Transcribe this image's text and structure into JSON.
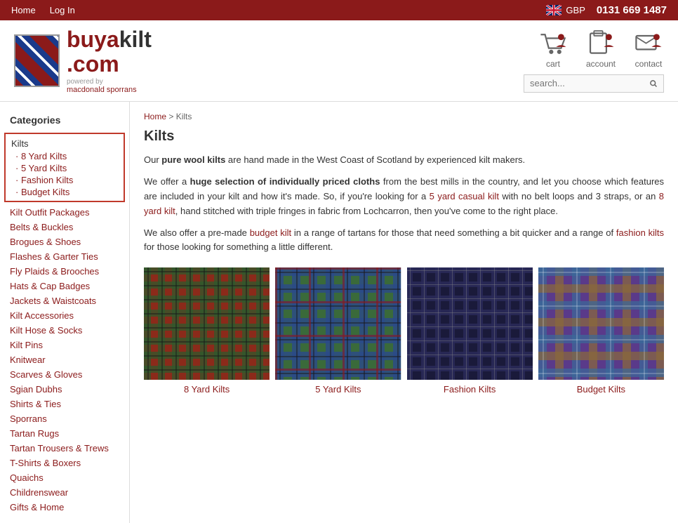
{
  "topnav": {
    "home": "Home",
    "login": "Log In",
    "currency": "GBP",
    "phone": "0131 669 1487"
  },
  "logo": {
    "brand_prefix": "buya",
    "brand_suffix": "kilt",
    "domain": ".com",
    "powered_by": "powered by",
    "powered_name": "macdonald sporrans"
  },
  "header_icons": {
    "cart_label": "cart",
    "account_label": "account",
    "contact_label": "contact"
  },
  "search": {
    "placeholder": "search..."
  },
  "breadcrumb": {
    "home": "Home",
    "separator": ">",
    "current": "Kilts"
  },
  "page_title": "Kilts",
  "content": {
    "para1_prefix": "Our ",
    "para1_bold": "pure wool kilts",
    "para1_suffix": " are hand made in the West Coast of Scotland by experienced kilt makers.",
    "para2_prefix": "We offer a ",
    "para2_bold": "huge selection of individually priced cloths",
    "para2_mid": " from the best mills in the country, and let you choose which features are included in your kilt and how it's made. So, if you're looking for a ",
    "para2_link1": "5 yard casual kilt",
    "para2_mid2": " with no belt loops and 3 straps, or an ",
    "para2_link2": "8 yard kilt",
    "para2_end": ", hand stitched with triple fringes in fabric from Lochcarron, then you've come to the right place.",
    "para3_prefix": "We also offer a pre-made ",
    "para3_link1": "budget kilt",
    "para3_mid": " in a range of tartans for those that need something a bit quicker and a range of ",
    "para3_link2": "fashion kilts",
    "para3_end": " for those looking for something a little different."
  },
  "sidebar": {
    "title": "Categories",
    "items": [
      {
        "label": "Kilts",
        "active": true,
        "subitems": [
          {
            "label": "· 8 Yard Kilts"
          },
          {
            "label": "· 5 Yard Kilts"
          },
          {
            "label": "· Fashion Kilts"
          },
          {
            "label": "· Budget Kilts"
          }
        ]
      },
      {
        "label": "Kilt Outfit Packages"
      },
      {
        "label": "Belts & Buckles"
      },
      {
        "label": "Brogues & Shoes"
      },
      {
        "label": "Flashes & Garter Ties"
      },
      {
        "label": "Fly Plaids & Brooches"
      },
      {
        "label": "Hats & Cap Badges"
      },
      {
        "label": "Jackets & Waistcoats"
      },
      {
        "label": "Kilt Accessories"
      },
      {
        "label": "Kilt Hose & Socks"
      },
      {
        "label": "Kilt Pins"
      },
      {
        "label": "Knitwear"
      },
      {
        "label": "Scarves & Gloves"
      },
      {
        "label": "Sgian Dubhs"
      },
      {
        "label": "Shirts & Ties"
      },
      {
        "label": "Sporrans"
      },
      {
        "label": "Tartan Rugs"
      },
      {
        "label": "Tartan Trousers & Trews"
      },
      {
        "label": "T-Shirts & Boxers"
      },
      {
        "label": "Quaichs"
      },
      {
        "label": "Childrenswear"
      },
      {
        "label": "Gifts & Home"
      }
    ]
  },
  "products": [
    {
      "label": "8 Yard Kilts",
      "kilt_class": "kilt-1"
    },
    {
      "label": "5 Yard Kilts",
      "kilt_class": "kilt-2"
    },
    {
      "label": "Fashion Kilts",
      "kilt_class": "kilt-3"
    },
    {
      "label": "Budget Kilts",
      "kilt_class": "kilt-4"
    }
  ]
}
